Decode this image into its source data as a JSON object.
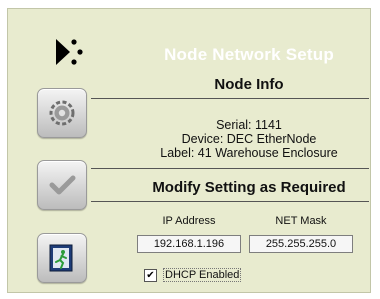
{
  "header": {
    "title": "Node Network Setup",
    "logo_icon": "dots-arrow-logo-icon"
  },
  "sidebar": {
    "buttons": [
      {
        "name": "settings-button",
        "icon": "gear-icon"
      },
      {
        "name": "apply-button",
        "icon": "checkmark-icon"
      },
      {
        "name": "exit-button",
        "icon": "exit-door-icon"
      }
    ]
  },
  "node_info": {
    "title": "Node Info",
    "serial": "Serial: 1141",
    "device": "Device: DEC EtherNode",
    "label": "Label: 41 Warehouse Enclosure"
  },
  "modify": {
    "title": "Modify Setting as Required",
    "ip_label": "IP Address",
    "ip_value": "192.168.1.196",
    "mask_label": "NET Mask",
    "mask_value": "255.255.255.0",
    "dhcp_label": "DHCP Enabled",
    "dhcp_check_mark": "✔",
    "dhcp_checked": true
  },
  "colors": {
    "panel_bg": "#e8ebcf",
    "title_text": "#ffffff"
  }
}
